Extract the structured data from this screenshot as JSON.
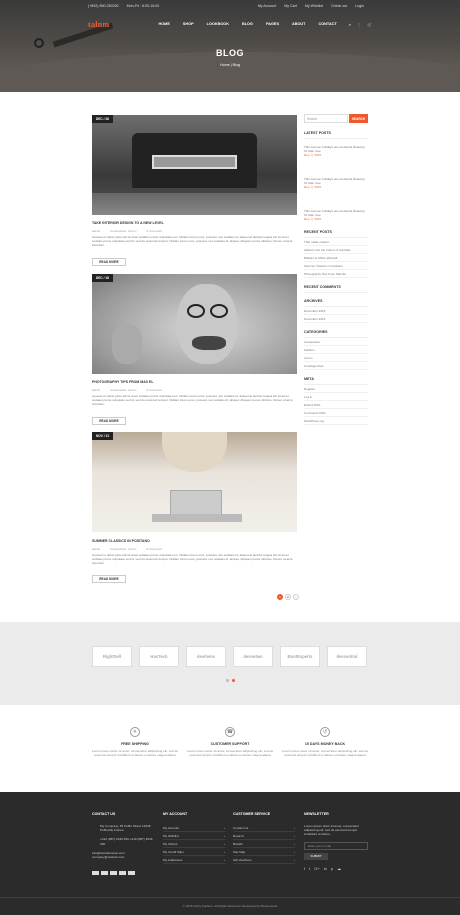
{
  "topbar": {
    "phone": "(+892) 850-250250",
    "hours": "Mon-Fri : 8:00-16:00",
    "account": "My Account",
    "cart": "My Cart",
    "wishlist": "My Wishlist",
    "checkout": "Check out",
    "login": "Login"
  },
  "header": {
    "logo": "talnm",
    "nav": [
      "HOME",
      "SHOP",
      "LOOKBOOK",
      "BLOG",
      "PAGES",
      "ABOUT",
      "CONTACT"
    ],
    "title": "BLOG",
    "breadcrumb": "Home | Blog"
  },
  "posts": [
    {
      "date": "DEC / 28",
      "title": "TAKE INTERIOR DESIGN TO A NEW LEVEL",
      "author": "admin",
      "cats": "Consectetur, Lorem",
      "comments": "0 Comment",
      "excerpt": "Aenean ut tellus justo elit sit amet sodales purus vulputate nec. Nullam lorem eros, posuere nec sodales id, aliquet at lacinia magna elit sit amet sodales purus vulputate sed id, sed do eiusmod tempor. Nullam lorem eros, posuere nec sodales id, aliquet. Aliquam purus ultricies. Donec viverra interdum.",
      "readmore": "READ MORE"
    },
    {
      "date": "DEC / 18",
      "title": "PHOTOGRAPHY TIPS FROM MAX EL",
      "author": "admin",
      "cats": "Consectetur, Lorem",
      "comments": "0 Comment",
      "excerpt": "Aenean ut tellus justo elit sit amet sodales purus vulputate nec. Nullam lorem eros, posuere nec sodales id, aliquet at lacinia magna elit sit amet sodales purus vulputate sed id, sed do eiusmod tempor. Nullam lorem eros, posuere nec sodales id, aliquet. Aliquam purus ultricies. Donec viverra interdum.",
      "readmore": "READ MORE"
    },
    {
      "date": "NOV / 21",
      "title": "SUMMER CLASSICS IN POSITANO",
      "author": "admin",
      "cats": "Consectetur, Lorem",
      "comments": "0 Comment",
      "excerpt": "Aenean ut tellus justo elit sit amet sodales purus vulputate nec. Nullam lorem eros, posuere nec sodales id, aliquet at lacinia magna elit sit amet sodales purus vulputate sed id, sed do eiusmod tempor. Nullam lorem eros, posuere nec sodales id, aliquet. Aliquam purus ultricies. Donec viverra interdum.",
      "readmore": "READ MORE"
    }
  ],
  "sidebar": {
    "search_placeholder": "Search",
    "search_btn": "SEARCH",
    "latest_posts": {
      "title": "LATEST POSTS",
      "items": [
        {
          "text": "This summer holidays are wonderful Relaxing for Men now",
          "date": "Dec. 3, 2015"
        },
        {
          "text": "This summer holidays are wonderful Relaxing for Men now",
          "date": "Dec. 3, 2015"
        },
        {
          "text": "This summer holidays are wonderful Relaxing for Men now",
          "date": "Dec. 3, 2015"
        }
      ]
    },
    "recent_posts": {
      "title": "RECENT POSTS",
      "items": [
        "That made modern",
        "Alliance into the Future of Australia",
        "Bulletin at Office affects&",
        "Summer Classics in Positano",
        "Photography Tips From Max Eu"
      ]
    },
    "recent_comments": {
      "title": "RECENT COMMENTS"
    },
    "archives": {
      "title": "ARCHIVES",
      "items": [
        "December 2015",
        "November 2015"
      ]
    },
    "categories": {
      "title": "CATEGORIES",
      "items": [
        "Consectetur",
        "Fashion",
        "Lorem",
        "Uncategorized"
      ]
    },
    "meta": {
      "title": "META",
      "items": [
        "Register",
        "Log in",
        "Entries RSS",
        "Comments RSS",
        "WordPress.org"
      ]
    }
  },
  "pager": [
    "1",
    "2",
    "›"
  ],
  "brands": [
    "RightSell",
    "HasTech",
    "devitems",
    "devnetwo",
    "BootExperts",
    "devcentral"
  ],
  "features": [
    {
      "icon": "✈",
      "title": "FREE SHIPPING",
      "text": "Lorem ipsum dolor sit amet, consectetur adipisicing elit, sed do eiusmod tempor incididunt ut labore et dolore magna aliqua"
    },
    {
      "icon": "☎",
      "title": "CUSTOMER SUPPORT",
      "text": "Lorem ipsum dolor sit amet, consectetur adipisicing elit, sed do eiusmod tempor incididunt ut labore et dolore magna aliqua"
    },
    {
      "icon": "↺",
      "title": "15 DAYS MONEY BACK",
      "text": "Lorem ipsum dolor sit amet, consectetur adipisicing elit, sed do eiusmod tempor incididunt ut labore et dolore magna aliqua"
    }
  ],
  "footer": {
    "contact": {
      "title": "CONTACT US",
      "address": "My Company, 45 Puffin Street 12345 Puffinville France",
      "phones": "+310 (987) 1646 350 +310 (987) 1646 350",
      "email": "info@domainname.com company@outlook.com"
    },
    "account": {
      "title": "MY ACCOUNT",
      "items": [
        "My Account",
        "My Wishlist",
        "My Orders",
        "My Credit Slips",
        "My Addresses"
      ]
    },
    "service": {
      "title": "CUSTOMER SERVICE",
      "items": [
        "Contact Us",
        "Returns",
        "Brands",
        "Site Map",
        "Gift Vouchers"
      ]
    },
    "newsletter": {
      "title": "NEWSLETTER",
      "text": "Lorem ipsum dolor sit amet, consectetur adipisicing elit, sed do eiusmod tempor incididunt ut labore.",
      "placeholder": "Enter your e-mail",
      "button": "SUBMIT"
    },
    "copyright": "© 2015 Crazy Fashion. All Rights Reserved. Developed by Bootexperts"
  }
}
